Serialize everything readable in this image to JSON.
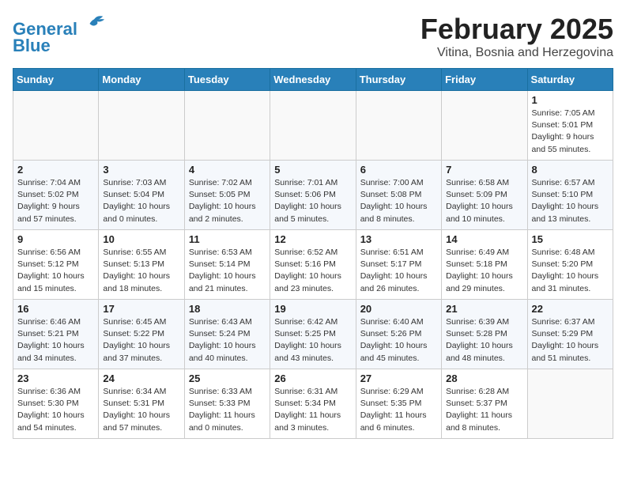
{
  "header": {
    "logo_line1": "General",
    "logo_line2": "Blue",
    "main_title": "February 2025",
    "subtitle": "Vitina, Bosnia and Herzegovina"
  },
  "weekdays": [
    "Sunday",
    "Monday",
    "Tuesday",
    "Wednesday",
    "Thursday",
    "Friday",
    "Saturday"
  ],
  "weeks": [
    [
      {
        "day": "",
        "info": ""
      },
      {
        "day": "",
        "info": ""
      },
      {
        "day": "",
        "info": ""
      },
      {
        "day": "",
        "info": ""
      },
      {
        "day": "",
        "info": ""
      },
      {
        "day": "",
        "info": ""
      },
      {
        "day": "1",
        "info": "Sunrise: 7:05 AM\nSunset: 5:01 PM\nDaylight: 9 hours and 55 minutes."
      }
    ],
    [
      {
        "day": "2",
        "info": "Sunrise: 7:04 AM\nSunset: 5:02 PM\nDaylight: 9 hours and 57 minutes."
      },
      {
        "day": "3",
        "info": "Sunrise: 7:03 AM\nSunset: 5:04 PM\nDaylight: 10 hours and 0 minutes."
      },
      {
        "day": "4",
        "info": "Sunrise: 7:02 AM\nSunset: 5:05 PM\nDaylight: 10 hours and 2 minutes."
      },
      {
        "day": "5",
        "info": "Sunrise: 7:01 AM\nSunset: 5:06 PM\nDaylight: 10 hours and 5 minutes."
      },
      {
        "day": "6",
        "info": "Sunrise: 7:00 AM\nSunset: 5:08 PM\nDaylight: 10 hours and 8 minutes."
      },
      {
        "day": "7",
        "info": "Sunrise: 6:58 AM\nSunset: 5:09 PM\nDaylight: 10 hours and 10 minutes."
      },
      {
        "day": "8",
        "info": "Sunrise: 6:57 AM\nSunset: 5:10 PM\nDaylight: 10 hours and 13 minutes."
      }
    ],
    [
      {
        "day": "9",
        "info": "Sunrise: 6:56 AM\nSunset: 5:12 PM\nDaylight: 10 hours and 15 minutes."
      },
      {
        "day": "10",
        "info": "Sunrise: 6:55 AM\nSunset: 5:13 PM\nDaylight: 10 hours and 18 minutes."
      },
      {
        "day": "11",
        "info": "Sunrise: 6:53 AM\nSunset: 5:14 PM\nDaylight: 10 hours and 21 minutes."
      },
      {
        "day": "12",
        "info": "Sunrise: 6:52 AM\nSunset: 5:16 PM\nDaylight: 10 hours and 23 minutes."
      },
      {
        "day": "13",
        "info": "Sunrise: 6:51 AM\nSunset: 5:17 PM\nDaylight: 10 hours and 26 minutes."
      },
      {
        "day": "14",
        "info": "Sunrise: 6:49 AM\nSunset: 5:18 PM\nDaylight: 10 hours and 29 minutes."
      },
      {
        "day": "15",
        "info": "Sunrise: 6:48 AM\nSunset: 5:20 PM\nDaylight: 10 hours and 31 minutes."
      }
    ],
    [
      {
        "day": "16",
        "info": "Sunrise: 6:46 AM\nSunset: 5:21 PM\nDaylight: 10 hours and 34 minutes."
      },
      {
        "day": "17",
        "info": "Sunrise: 6:45 AM\nSunset: 5:22 PM\nDaylight: 10 hours and 37 minutes."
      },
      {
        "day": "18",
        "info": "Sunrise: 6:43 AM\nSunset: 5:24 PM\nDaylight: 10 hours and 40 minutes."
      },
      {
        "day": "19",
        "info": "Sunrise: 6:42 AM\nSunset: 5:25 PM\nDaylight: 10 hours and 43 minutes."
      },
      {
        "day": "20",
        "info": "Sunrise: 6:40 AM\nSunset: 5:26 PM\nDaylight: 10 hours and 45 minutes."
      },
      {
        "day": "21",
        "info": "Sunrise: 6:39 AM\nSunset: 5:28 PM\nDaylight: 10 hours and 48 minutes."
      },
      {
        "day": "22",
        "info": "Sunrise: 6:37 AM\nSunset: 5:29 PM\nDaylight: 10 hours and 51 minutes."
      }
    ],
    [
      {
        "day": "23",
        "info": "Sunrise: 6:36 AM\nSunset: 5:30 PM\nDaylight: 10 hours and 54 minutes."
      },
      {
        "day": "24",
        "info": "Sunrise: 6:34 AM\nSunset: 5:31 PM\nDaylight: 10 hours and 57 minutes."
      },
      {
        "day": "25",
        "info": "Sunrise: 6:33 AM\nSunset: 5:33 PM\nDaylight: 11 hours and 0 minutes."
      },
      {
        "day": "26",
        "info": "Sunrise: 6:31 AM\nSunset: 5:34 PM\nDaylight: 11 hours and 3 minutes."
      },
      {
        "day": "27",
        "info": "Sunrise: 6:29 AM\nSunset: 5:35 PM\nDaylight: 11 hours and 6 minutes."
      },
      {
        "day": "28",
        "info": "Sunrise: 6:28 AM\nSunset: 5:37 PM\nDaylight: 11 hours and 8 minutes."
      },
      {
        "day": "",
        "info": ""
      }
    ]
  ]
}
